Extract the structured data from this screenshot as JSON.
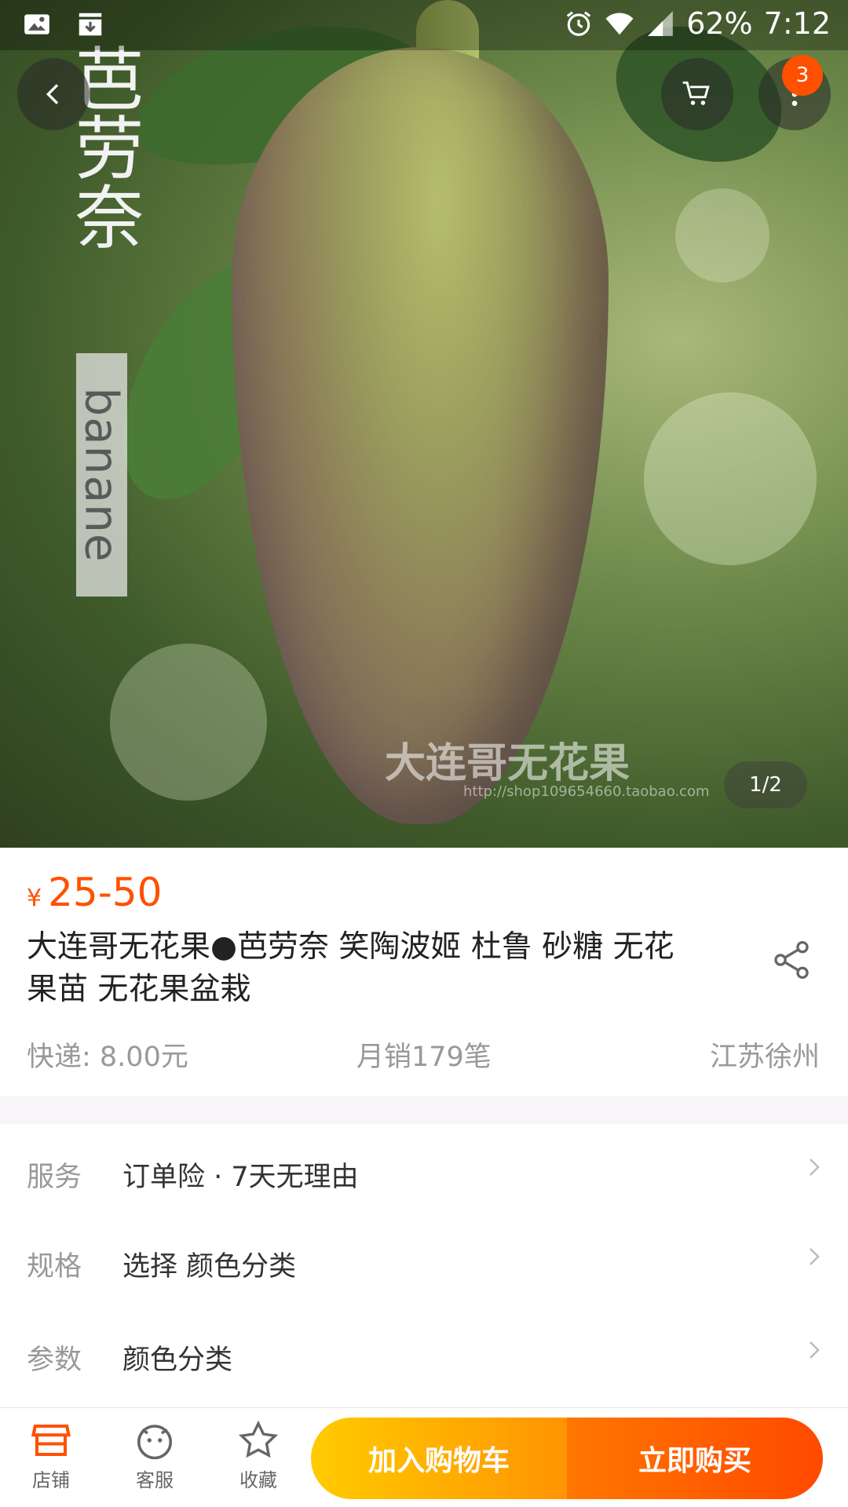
{
  "status_bar": {
    "battery": "62%",
    "time": "7:12",
    "icons": [
      "image-icon",
      "download-icon",
      "alarm-icon",
      "wifi-icon",
      "signal-icon"
    ]
  },
  "header": {
    "back_icon": "chevron-left-icon",
    "cart_icon": "cart-icon",
    "more_icon": "more-vertical-icon",
    "more_badge": "3"
  },
  "hero": {
    "vertical_text": "芭劳奈",
    "vertical_latin": "banane",
    "watermark": "大连哥无花果",
    "watermark_url": "http://shop109654660.taobao.com",
    "page_indicator": "1/2"
  },
  "product": {
    "currency": "¥",
    "price": "25-50",
    "title": "大连哥无花果●芭劳奈 笑陶波姬 杜鲁 砂糖 无花果苗 无花果盆栽",
    "shipping": "快递: 8.00元",
    "monthly_sales": "月销179笔",
    "location": "江苏徐州"
  },
  "options": [
    {
      "label": "服务",
      "value": "订单险 · 7天无理由"
    },
    {
      "label": "规格",
      "value": "选择 颜色分类"
    },
    {
      "label": "参数",
      "value": "颜色分类"
    }
  ],
  "bottom_bar": {
    "shop_label": "店铺",
    "service_label": "客服",
    "favorite_label": "收藏",
    "add_cart_label": "加入购物车",
    "buy_now_label": "立即购买"
  },
  "colors": {
    "accent": "#ff5000",
    "cart_button": "#ffb300",
    "buy_button": "#ff5a00"
  }
}
